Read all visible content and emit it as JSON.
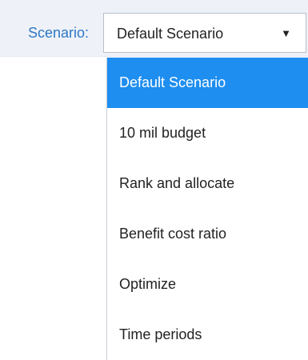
{
  "toolbar": {
    "label": "Scenario:",
    "select": {
      "value": "Default Scenario",
      "caret": "▼",
      "caret_icon": "triangle-down-icon"
    }
  },
  "dropdown": {
    "selected_index": 0,
    "selected_color": "#1e8ef0",
    "options": [
      {
        "label": "Default Scenario"
      },
      {
        "label": "10 mil budget"
      },
      {
        "label": "Rank and allocate"
      },
      {
        "label": "Benefit cost ratio"
      },
      {
        "label": "Optimize"
      },
      {
        "label": "Time periods"
      }
    ]
  }
}
